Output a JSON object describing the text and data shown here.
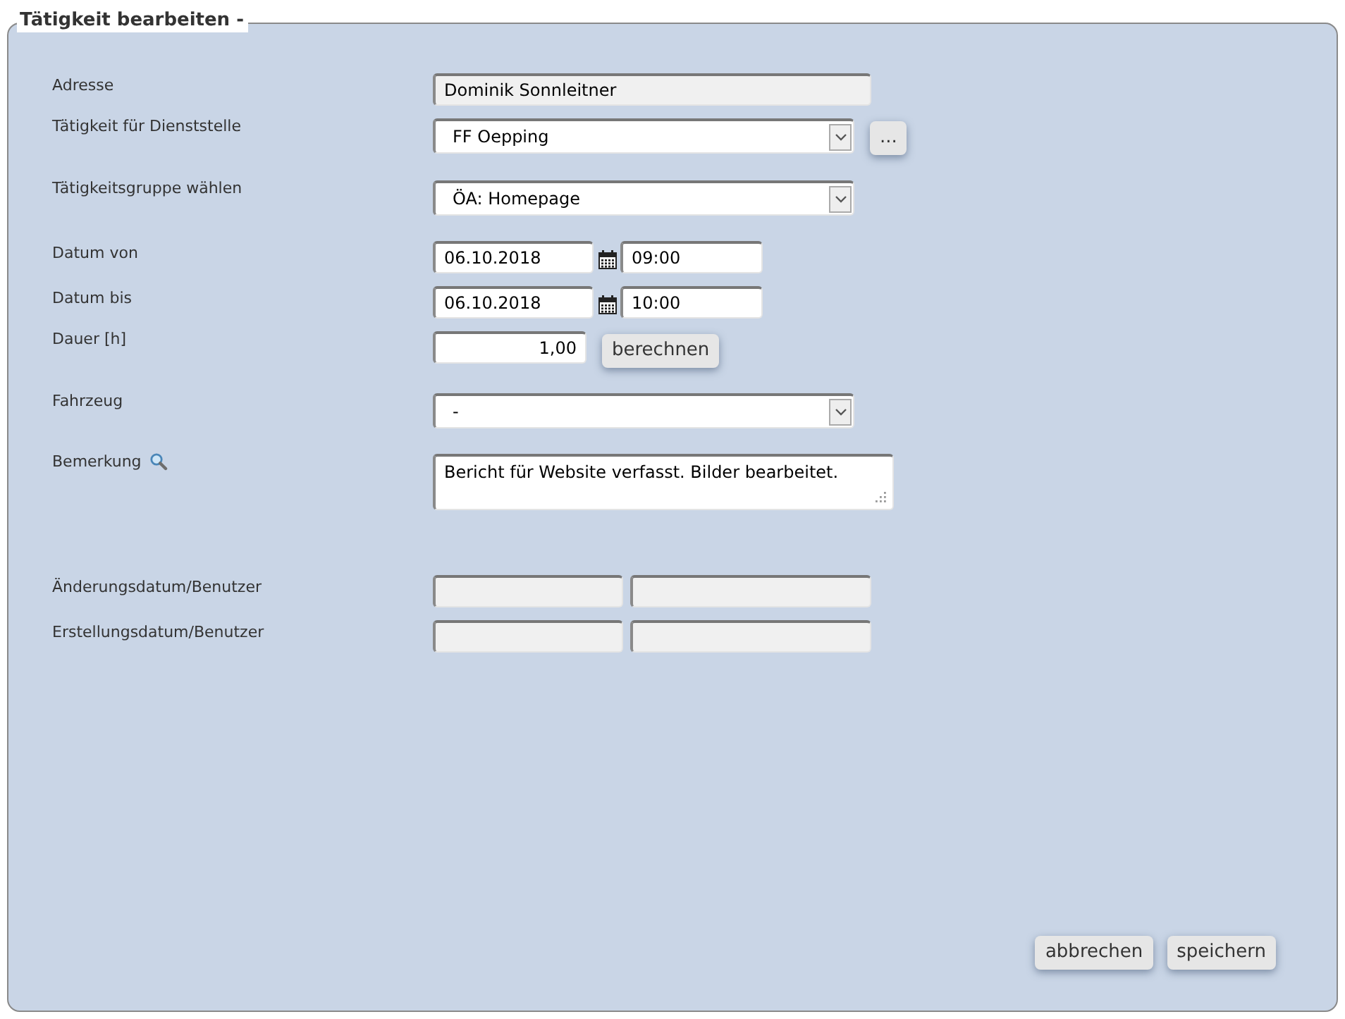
{
  "legend": "Tätigkeit bearbeiten -",
  "rows": [
    {
      "kind": "text",
      "label": "Adresse",
      "value": "Dominik Sonnleitner",
      "readonly": true
    },
    {
      "kind": "select",
      "label": "Tätigkeit für Dienststelle",
      "value": "FF Oepping",
      "button": "..."
    },
    {
      "kind": "select",
      "label": "Tätigkeitsgruppe wählen",
      "value": "ÖA: Homepage"
    },
    {
      "kind": "datetime",
      "label": "Datum von",
      "date": "06.10.2018",
      "time": "09:00"
    },
    {
      "kind": "datetime",
      "label": "Datum bis",
      "date": "06.10.2018",
      "time": "10:00"
    },
    {
      "kind": "number",
      "label": "Dauer [h]",
      "value": "1,00",
      "button": "berechnen"
    },
    {
      "kind": "select",
      "label": "Fahrzeug",
      "value": "-"
    },
    {
      "kind": "textarea",
      "label": "Bemerkung",
      "value": "Bericht für Website verfasst. Bilder bearbeitet."
    },
    {
      "kind": "pair",
      "label": "Änderungsdatum/Benutzer",
      "readonly": true
    },
    {
      "kind": "pair",
      "label": "Erstellungsdatum/Benutzer",
      "readonly": true
    }
  ],
  "buttons": [
    "abbrechen",
    "speichern"
  ]
}
